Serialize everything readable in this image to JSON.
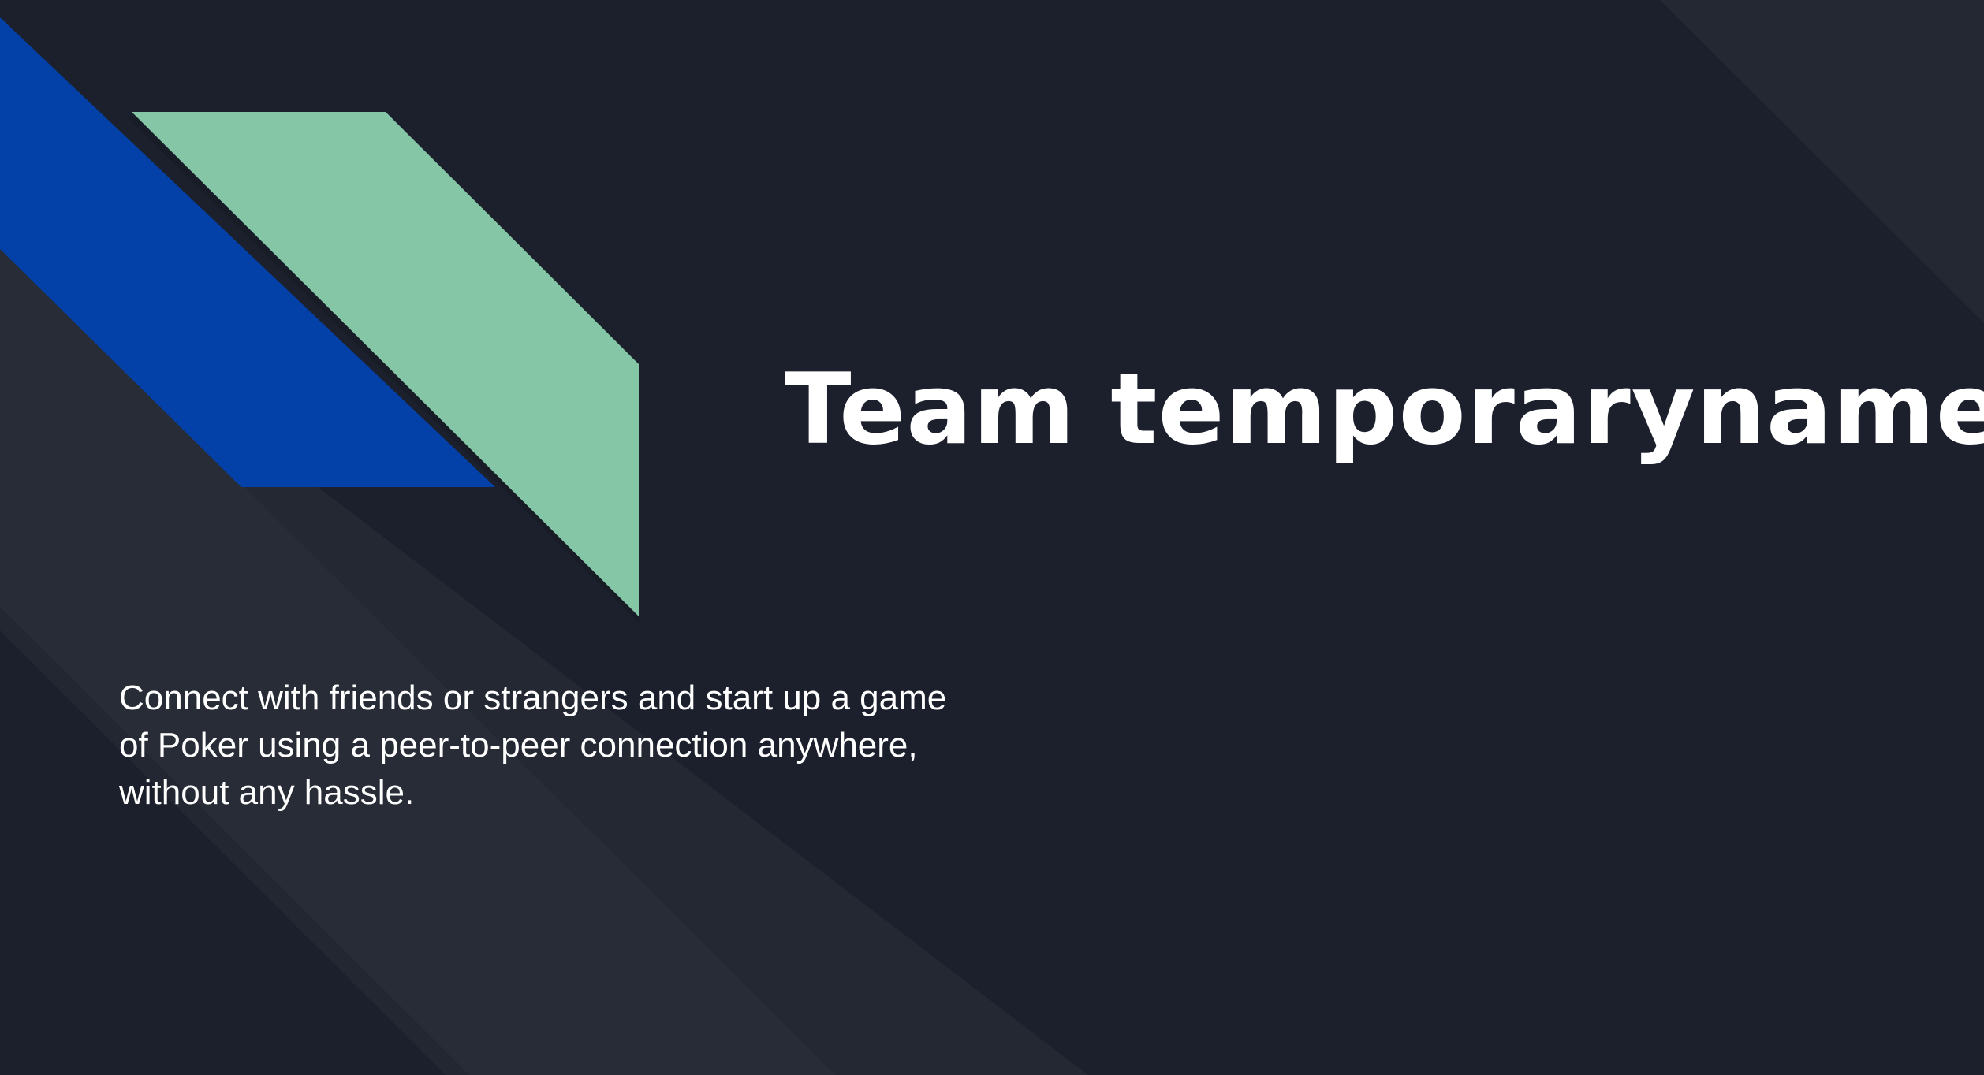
{
  "slide": {
    "title": "Team temporaryname",
    "subtitle": "Connect with friends or strangers and start up a game of Poker using a peer-to-peer connection anywhere, without any hassle."
  },
  "colors": {
    "background": "#1b202c",
    "band_light": "#272c36",
    "accent_blue": "#0341a8",
    "accent_green": "#84c6a5",
    "text": "#ffffff"
  },
  "decorations": [
    "diagonal-band-bottom-left",
    "diagonal-band-top-right",
    "blue-parallelogram",
    "green-parallelogram"
  ]
}
